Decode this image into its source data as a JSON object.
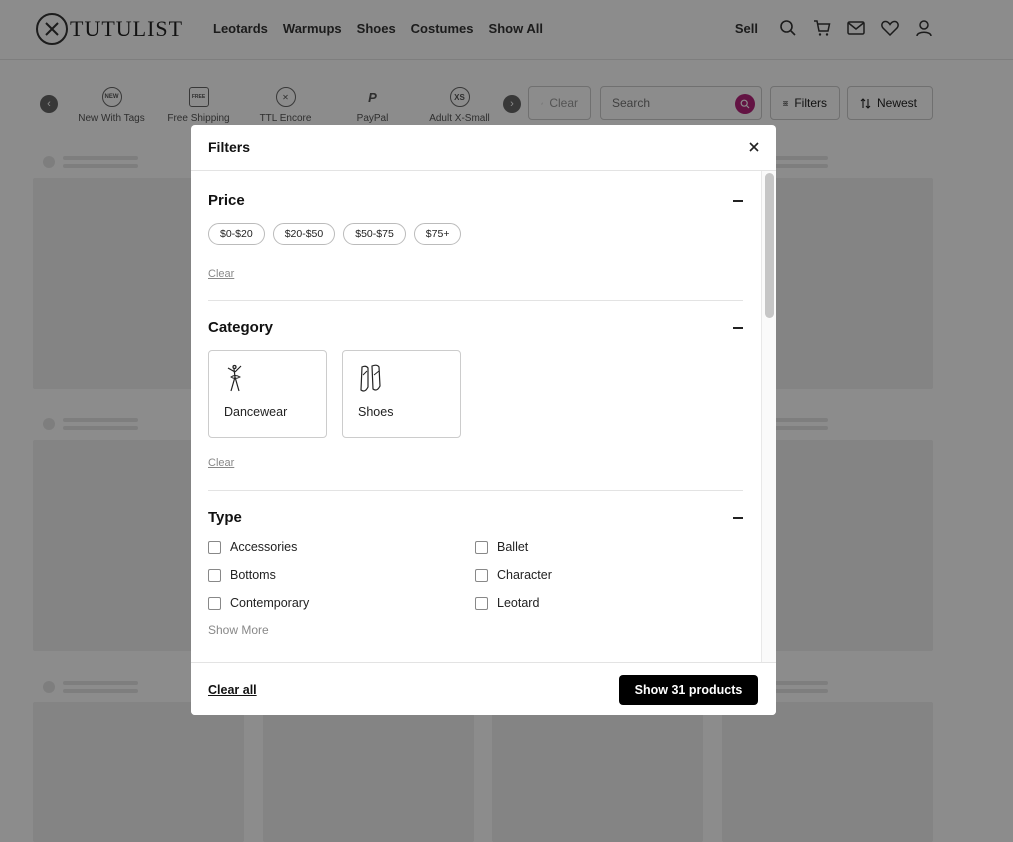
{
  "header": {
    "logo_text": "TUTULIST",
    "nav": [
      "Leotards",
      "Warmups",
      "Shoes",
      "Costumes",
      "Show All"
    ],
    "sell_label": "Sell",
    "icons": [
      "search-icon",
      "cart-icon",
      "mail-icon",
      "heart-icon",
      "user-icon"
    ]
  },
  "filter_bar": {
    "tags": [
      {
        "label": "New With Tags",
        "icon": "NEW"
      },
      {
        "label": "Free Shipping",
        "icon": "FREE"
      },
      {
        "label": "TTL Encore",
        "icon": "✕"
      },
      {
        "label": "PayPal",
        "icon": "P"
      },
      {
        "label": "Adult X-Small",
        "icon": "XS"
      }
    ],
    "clear_label": "Clear",
    "search_placeholder": "Search",
    "filters_label": "Filters",
    "sort_label": "Newest"
  },
  "modal": {
    "title": "Filters",
    "price": {
      "title": "Price",
      "chips": [
        "$0-$20",
        "$20-$50",
        "$50-$75",
        "$75+"
      ],
      "clear_label": "Clear"
    },
    "category": {
      "title": "Category",
      "items": [
        "Dancewear",
        "Shoes"
      ],
      "clear_label": "Clear"
    },
    "type": {
      "title": "Type",
      "options": [
        "Accessories",
        "Ballet",
        "Bottoms",
        "Character",
        "Contemporary",
        "Leotard"
      ],
      "show_more_label": "Show More"
    },
    "footer": {
      "clear_all_label": "Clear all",
      "show_button_label": "Show 31 products"
    }
  },
  "colors": {
    "accent": "#b5237a",
    "primary_button": "#000000",
    "overlay": "rgba(0,0,0,0.45)"
  }
}
